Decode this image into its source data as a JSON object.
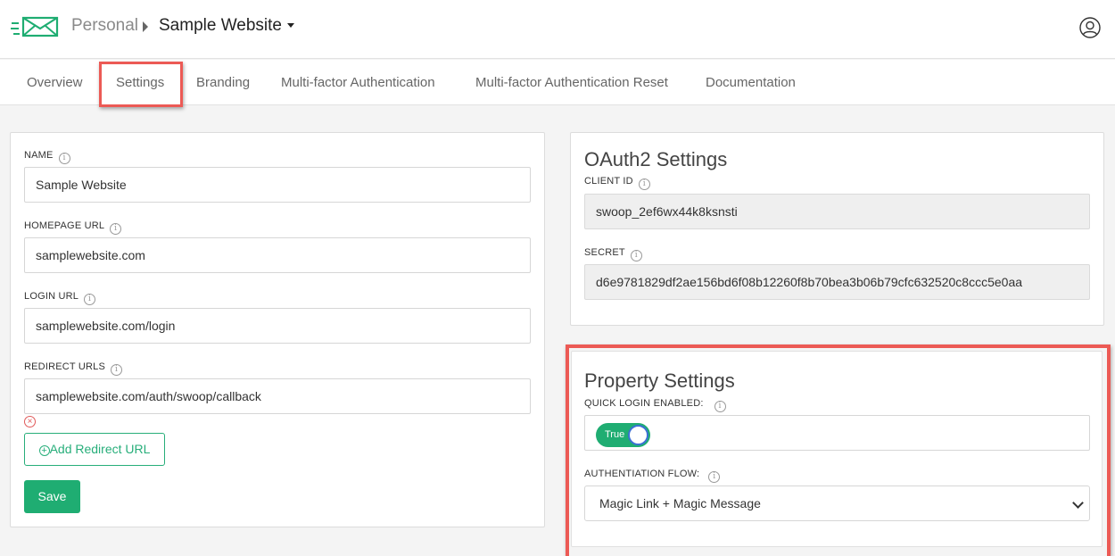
{
  "header": {
    "breadcrumb_org": "Personal",
    "breadcrumb_site": "Sample Website",
    "logo_icon": "envelope-logo-icon",
    "user_icon": "user-account-icon"
  },
  "tabs": [
    {
      "label": "Overview"
    },
    {
      "label": "Settings",
      "active": true
    },
    {
      "label": "Branding"
    },
    {
      "label": "Multi-factor Authentication"
    },
    {
      "label": "Multi-factor Authentication Reset"
    },
    {
      "label": "Documentation"
    }
  ],
  "site_form": {
    "name_label": "NAME",
    "name_value": "Sample Website",
    "homepage_label": "HOMEPAGE URL",
    "homepage_value": "samplewebsite.com",
    "login_label": "LOGIN URL",
    "login_value": "samplewebsite.com/login",
    "redirect_label": "REDIRECT URLS",
    "redirect_values": [
      "samplewebsite.com/auth/swoop/callback"
    ],
    "add_redirect_label": "Add Redirect URL",
    "save_label": "Save"
  },
  "oauth": {
    "title": "OAuth2 Settings",
    "client_id_label": "CLIENT ID",
    "client_id_value": "swoop_2ef6wx44k8ksnsti",
    "secret_label": "SECRET",
    "secret_value": "d6e9781829df2ae156bd6f08b12260f8b70bea3b06b79cfc632520c8ccc5e0aa"
  },
  "property": {
    "title": "Property Settings",
    "quick_login_label": "QUICK LOGIN ENABLED:",
    "quick_login_value": "True",
    "auth_flow_label": "AUTHENTIATION FLOW:",
    "auth_flow_value": "Magic Link + Magic Message"
  },
  "colors": {
    "accent_green": "#1fad72",
    "highlight_red": "#ec5a55"
  }
}
